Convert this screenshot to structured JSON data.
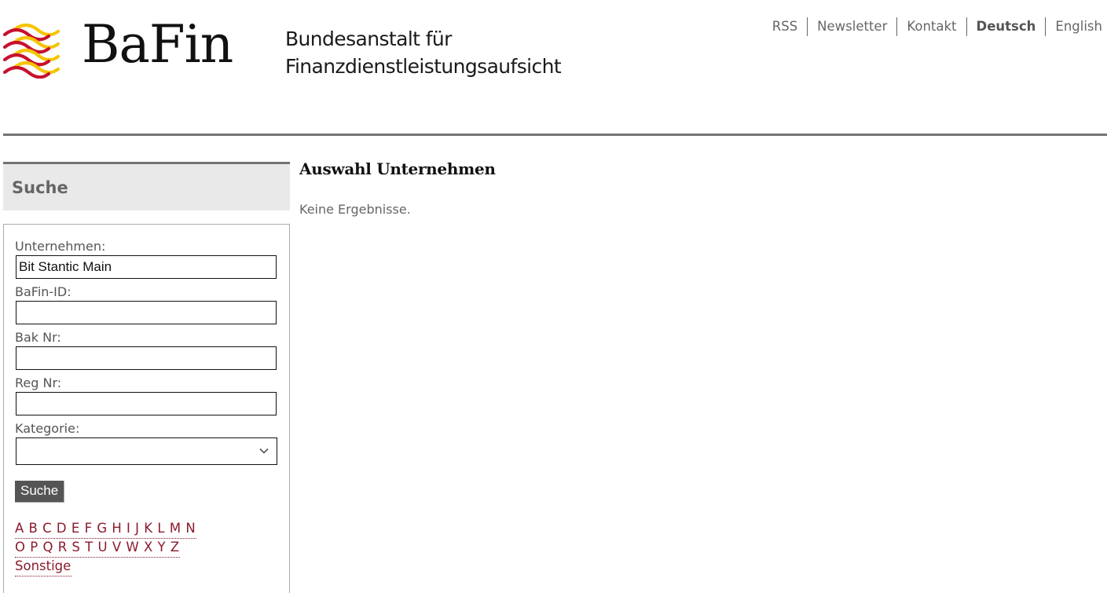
{
  "header": {
    "logo_text": "BaFin",
    "subtitle_line1": "Bundesanstalt für",
    "subtitle_line2": "Finanzdienstleistungsaufsicht",
    "logo_colors": {
      "red": "#c8102e",
      "yellow": "#f5c400"
    },
    "nav": [
      {
        "label": "RSS"
      },
      {
        "label": "Newsletter"
      },
      {
        "label": "Kontakt"
      },
      {
        "label": "Deutsch",
        "active": true
      },
      {
        "label": "English"
      }
    ]
  },
  "sidebar": {
    "title": "Suche",
    "fields": {
      "company": {
        "label": "Unternehmen:",
        "value": "Bit Stantic Main"
      },
      "bafin_id": {
        "label": "BaFin-ID:",
        "value": ""
      },
      "bak_nr": {
        "label": "Bak Nr:",
        "value": ""
      },
      "reg_nr": {
        "label": "Reg Nr:",
        "value": ""
      },
      "category": {
        "label": "Kategorie:",
        "selected": ""
      }
    },
    "submit_label": "Suche",
    "alphabet_row1": [
      "A",
      "B",
      "C",
      "D",
      "E",
      "F",
      "G",
      "H",
      "I",
      "J",
      "K",
      "L",
      "M",
      "N"
    ],
    "alphabet_row2": [
      "O",
      "P",
      "Q",
      "R",
      "S",
      "T",
      "U",
      "V",
      "W",
      "X",
      "Y",
      "Z"
    ],
    "other_label": "Sonstige",
    "link_color": "#8b1a2b"
  },
  "main": {
    "title": "Auswahl Unternehmen",
    "message": "Keine Ergebnisse."
  }
}
